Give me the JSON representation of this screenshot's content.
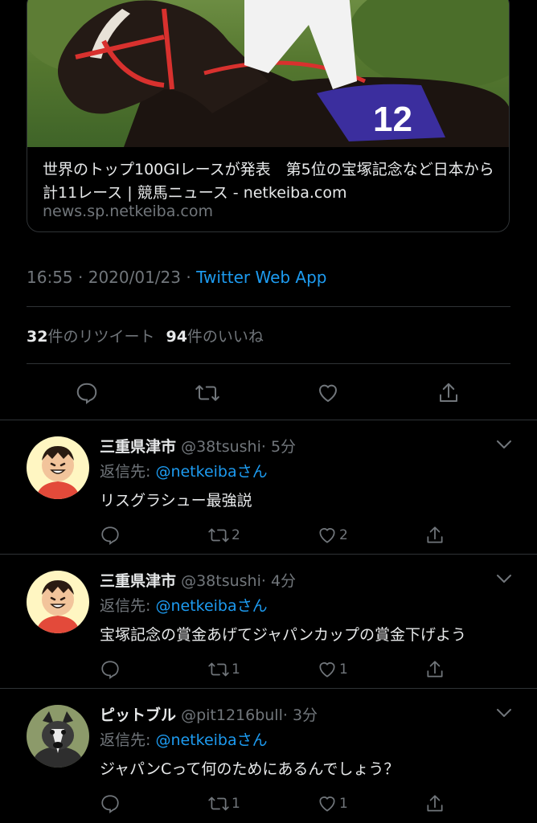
{
  "link_card": {
    "title": "世界のトップ100GIレースが発表　第5位の宝塚記念など日本から計11レース | 競馬ニュース - netkeiba.com",
    "domain": "news.sp.netkeiba.com",
    "saddle_number": "12"
  },
  "tweet_meta": {
    "time": "16:55",
    "separator": " · ",
    "date": "2020/01/23",
    "app": "Twitter Web App"
  },
  "stats": {
    "retweets_count": "32",
    "retweets_label": "件のリツイート",
    "likes_count": "94",
    "likes_label": "件のいいね"
  },
  "icons": {
    "reply": "reply-icon",
    "retweet": "retweet-icon",
    "like": "heart-icon",
    "share": "share-icon",
    "more": "chevron-down-icon"
  },
  "colors": {
    "background": "#000000",
    "divider": "#2f3336",
    "muted": "#71767b",
    "accent": "#1d9bf0"
  },
  "replies": [
    {
      "name": "三重県津市",
      "handle": "@38tsushi",
      "time": "· 5分",
      "reply_prefix": "返信先: ",
      "reply_to": "@netkeibaさん",
      "text": "リスグラシュー最強説",
      "retweets": "2",
      "likes": "2"
    },
    {
      "name": "三重県津市",
      "handle": "@38tsushi",
      "time": "· 4分",
      "reply_prefix": "返信先: ",
      "reply_to": "@netkeibaさん",
      "text": "宝塚記念の賞金あげてジャパンカップの賞金下げよう",
      "retweets": "1",
      "likes": "1"
    },
    {
      "name": "ピットブル",
      "handle": "@pit1216bull",
      "time": "· 3分",
      "reply_prefix": "返信先: ",
      "reply_to": "@netkeibaさん",
      "text": "ジャパンCって何のためにあるんでしょう？",
      "retweets": "1",
      "likes": "1"
    }
  ]
}
